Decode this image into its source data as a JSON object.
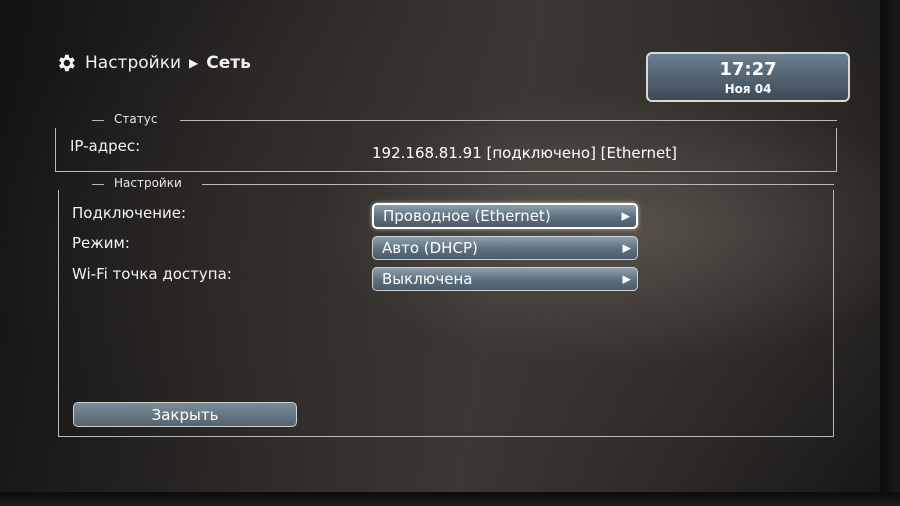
{
  "breadcrumb": {
    "icon": "gear-icon",
    "parent": "Настройки",
    "separator": "▶",
    "current": "Сеть"
  },
  "clock": {
    "time": "17:27",
    "date": "Ноя 04"
  },
  "status": {
    "legend": "Статус",
    "ip_label": "IP-адрес:",
    "ip_value": "192.168.81.91 [подключено] [Ethernet]"
  },
  "settings": {
    "legend": "Настройки",
    "rows": [
      {
        "label": "Подключение:",
        "value": "Проводное (Ethernet)",
        "arrow": "▶",
        "focused": true
      },
      {
        "label": "Режим:",
        "value": "Авто (DHCP)",
        "arrow": "▶",
        "focused": false
      },
      {
        "label": "Wi-Fi точка доступа:",
        "value": "Выключена",
        "arrow": "▶",
        "focused": false
      }
    ]
  },
  "close_button": "Закрыть",
  "colors": {
    "button_top": "#8aa0b0",
    "button_bottom": "#4c5b67",
    "border": "#b9b9b9",
    "text": "#ffffff"
  }
}
